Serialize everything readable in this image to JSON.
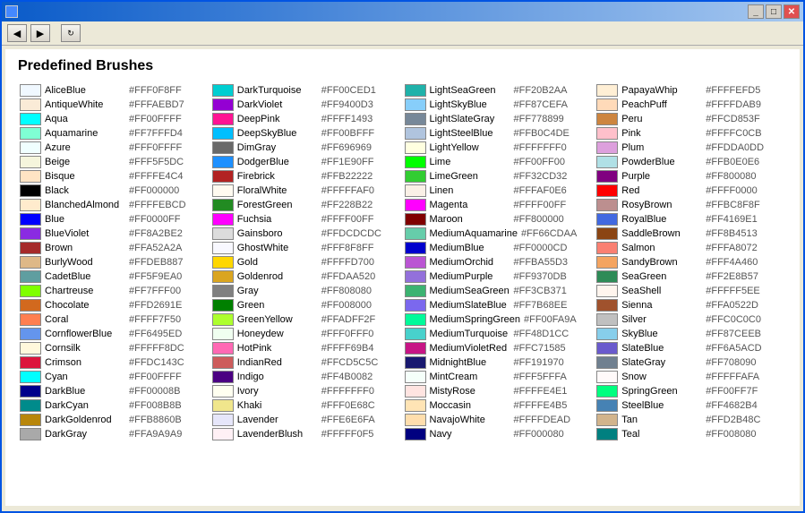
{
  "window": {
    "title": "Predefined Brushes",
    "titlebar_title": ""
  },
  "page": {
    "heading": "Predefined Brushes"
  },
  "colors": [
    {
      "name": "AliceBlue",
      "hex": "#FFF0F8FF",
      "color": "#F0F8FF"
    },
    {
      "name": "AntiqueWhite",
      "hex": "#FFFAEBD7",
      "color": "#FAEBD7"
    },
    {
      "name": "Aqua",
      "hex": "#FF00FFFF",
      "color": "#00FFFF"
    },
    {
      "name": "Aquamarine",
      "hex": "#FF7FFFD4",
      "color": "#7FFFD4"
    },
    {
      "name": "Azure",
      "hex": "#FFF0FFFF",
      "color": "#F0FFFF"
    },
    {
      "name": "Beige",
      "hex": "#FFF5F5DC",
      "color": "#F5F5DC"
    },
    {
      "name": "Bisque",
      "hex": "#FFFFE4C4",
      "color": "#FFE4C4"
    },
    {
      "name": "Black",
      "hex": "#FF000000",
      "color": "#000000"
    },
    {
      "name": "BlanchedAlmond",
      "hex": "#FFFFEBCD",
      "color": "#FFEBCD"
    },
    {
      "name": "Blue",
      "hex": "#FF0000FF",
      "color": "#0000FF"
    },
    {
      "name": "BlueViolet",
      "hex": "#FF8A2BE2",
      "color": "#8A2BE2"
    },
    {
      "name": "Brown",
      "hex": "#FFA52A2A",
      "color": "#A52A2A"
    },
    {
      "name": "BurlyWood",
      "hex": "#FFDEB887",
      "color": "#DEB887"
    },
    {
      "name": "CadetBlue",
      "hex": "#FF5F9EA0",
      "color": "#5F9EA0"
    },
    {
      "name": "Chartreuse",
      "hex": "#FF7FFF00",
      "color": "#7FFF00"
    },
    {
      "name": "Chocolate",
      "hex": "#FFD2691E",
      "color": "#D2691E"
    },
    {
      "name": "Coral",
      "hex": "#FFFF7F50",
      "color": "#FF7F50"
    },
    {
      "name": "CornflowerBlue",
      "hex": "#FF6495ED",
      "color": "#6495ED"
    },
    {
      "name": "Cornsilk",
      "hex": "#FFFFF8DC",
      "color": "#FFF8DC"
    },
    {
      "name": "Crimson",
      "hex": "#FFDC143C",
      "color": "#DC143C"
    },
    {
      "name": "Cyan",
      "hex": "#FF00FFFF",
      "color": "#00FFFF"
    },
    {
      "name": "DarkBlue",
      "hex": "#FF00008B",
      "color": "#00008B"
    },
    {
      "name": "DarkCyan",
      "hex": "#FF008B8B",
      "color": "#008B8B"
    },
    {
      "name": "DarkGoldenrod",
      "hex": "#FFB8860B",
      "color": "#B8860B"
    },
    {
      "name": "DarkGray",
      "hex": "#FFA9A9A9",
      "color": "#A9A9A9"
    },
    {
      "name": "DarkTurquoise",
      "hex": "#FF00CED1",
      "color": "#00CED1"
    },
    {
      "name": "DarkViolet",
      "hex": "#FF9400D3",
      "color": "#9400D3"
    },
    {
      "name": "DeepPink",
      "hex": "#FFFF1493",
      "color": "#FF1493"
    },
    {
      "name": "DeepSkyBlue",
      "hex": "#FF00BFFF",
      "color": "#00BFFF"
    },
    {
      "name": "DimGray",
      "hex": "#FF696969",
      "color": "#696969"
    },
    {
      "name": "DodgerBlue",
      "hex": "#FF1E90FF",
      "color": "#1E90FF"
    },
    {
      "name": "Firebrick",
      "hex": "#FFB22222",
      "color": "#B22222"
    },
    {
      "name": "FloralWhite",
      "hex": "#FFFFFAF0",
      "color": "#FFFAF0"
    },
    {
      "name": "ForestGreen",
      "hex": "#FF228B22",
      "color": "#228B22"
    },
    {
      "name": "Fuchsia",
      "hex": "#FFFF00FF",
      "color": "#FF00FF"
    },
    {
      "name": "Gainsboro",
      "hex": "#FFDCDCDC",
      "color": "#DCDCDC"
    },
    {
      "name": "GhostWhite",
      "hex": "#FFF8F8FF",
      "color": "#F8F8FF"
    },
    {
      "name": "Gold",
      "hex": "#FFFFD700",
      "color": "#FFD700"
    },
    {
      "name": "Goldenrod",
      "hex": "#FFDAA520",
      "color": "#DAA520"
    },
    {
      "name": "Gray",
      "hex": "#FF808080",
      "color": "#808080"
    },
    {
      "name": "Green",
      "hex": "#FF008000",
      "color": "#008000"
    },
    {
      "name": "GreenYellow",
      "hex": "#FFADFF2F",
      "color": "#ADFF2F"
    },
    {
      "name": "Honeydew",
      "hex": "#FFF0FFF0",
      "color": "#F0FFF0"
    },
    {
      "name": "HotPink",
      "hex": "#FFFF69B4",
      "color": "#FF69B4"
    },
    {
      "name": "IndianRed",
      "hex": "#FFCD5C5C",
      "color": "#CD5C5C"
    },
    {
      "name": "Indigo",
      "hex": "#FF4B0082",
      "color": "#4B0082"
    },
    {
      "name": "Ivory",
      "hex": "#FFFFFFF0",
      "color": "#FFFFF0"
    },
    {
      "name": "Khaki",
      "hex": "#FFF0E68C",
      "color": "#F0E68C"
    },
    {
      "name": "Lavender",
      "hex": "#FFE6E6FA",
      "color": "#E6E6FA"
    },
    {
      "name": "LavenderBlush",
      "hex": "#FFFFF0F5",
      "color": "#FFF0F5"
    },
    {
      "name": "LightSeaGreen",
      "hex": "#FF20B2AA",
      "color": "#20B2AA"
    },
    {
      "name": "LightSkyBlue",
      "hex": "#FF87CEFA",
      "color": "#87CEFA"
    },
    {
      "name": "LightSlateGray",
      "hex": "#FF778899",
      "color": "#778899"
    },
    {
      "name": "LightSteelBlue",
      "hex": "#FFB0C4DE",
      "color": "#B0C4DE"
    },
    {
      "name": "LightYellow",
      "hex": "#FFFFFFF0",
      "color": "#FFFFE0"
    },
    {
      "name": "Lime",
      "hex": "#FF00FF00",
      "color": "#00FF00"
    },
    {
      "name": "LimeGreen",
      "hex": "#FF32CD32",
      "color": "#32CD32"
    },
    {
      "name": "Linen",
      "hex": "#FFFAF0E6",
      "color": "#FAF0E6"
    },
    {
      "name": "Magenta",
      "hex": "#FFFF00FF",
      "color": "#FF00FF"
    },
    {
      "name": "Maroon",
      "hex": "#FF800000",
      "color": "#800000"
    },
    {
      "name": "MediumAquamarine",
      "hex": "#FF66CDAA",
      "color": "#66CDAA"
    },
    {
      "name": "MediumBlue",
      "hex": "#FF0000CD",
      "color": "#0000CD"
    },
    {
      "name": "MediumOrchid",
      "hex": "#FFBA55D3",
      "color": "#BA55D3"
    },
    {
      "name": "MediumPurple",
      "hex": "#FF9370DB",
      "color": "#9370DB"
    },
    {
      "name": "MediumSeaGreen",
      "hex": "#FF3CB371",
      "color": "#3CB371"
    },
    {
      "name": "MediumSlateBlue",
      "hex": "#FF7B68EE",
      "color": "#7B68EE"
    },
    {
      "name": "MediumSpringGreen",
      "hex": "#FF00FA9A",
      "color": "#00FA9A"
    },
    {
      "name": "MediumTurquoise",
      "hex": "#FF48D1CC",
      "color": "#48D1CC"
    },
    {
      "name": "MediumVioletRed",
      "hex": "#FFC71585",
      "color": "#C71585"
    },
    {
      "name": "MidnightBlue",
      "hex": "#FF191970",
      "color": "#191970"
    },
    {
      "name": "MintCream",
      "hex": "#FFF5FFFA",
      "color": "#F5FFFA"
    },
    {
      "name": "MistyRose",
      "hex": "#FFFFE4E1",
      "color": "#FFE4E1"
    },
    {
      "name": "Moccasin",
      "hex": "#FFFFE4B5",
      "color": "#FFE4B5"
    },
    {
      "name": "NavajoWhite",
      "hex": "#FFFFDEAD",
      "color": "#FFDEAD"
    },
    {
      "name": "Navy",
      "hex": "#FF000080",
      "color": "#000080"
    },
    {
      "name": "PapayaWhip",
      "hex": "#FFFFEFD5",
      "color": "#FFEFD5"
    },
    {
      "name": "PeachPuff",
      "hex": "#FFFFDAB9",
      "color": "#FFDAB9"
    },
    {
      "name": "Peru",
      "hex": "#FFCD853F",
      "color": "#CD853F"
    },
    {
      "name": "Pink",
      "hex": "#FFFFC0CB",
      "color": "#FFC0CB"
    },
    {
      "name": "Plum",
      "hex": "#FFDDA0DD",
      "color": "#DDA0DD"
    },
    {
      "name": "PowderBlue",
      "hex": "#FFB0E0E6",
      "color": "#B0E0E6"
    },
    {
      "name": "Purple",
      "hex": "#FF800080",
      "color": "#800080"
    },
    {
      "name": "Red",
      "hex": "#FFFF0000",
      "color": "#FF0000"
    },
    {
      "name": "RosyBrown",
      "hex": "#FFBC8F8F",
      "color": "#BC8F8F"
    },
    {
      "name": "RoyalBlue",
      "hex": "#FF4169E1",
      "color": "#4169E1"
    },
    {
      "name": "SaddleBrown",
      "hex": "#FF8B4513",
      "color": "#8B4513"
    },
    {
      "name": "Salmon",
      "hex": "#FFFA8072",
      "color": "#FA8072"
    },
    {
      "name": "SandyBrown",
      "hex": "#FFF4A460",
      "color": "#F4A460"
    },
    {
      "name": "SeaGreen",
      "hex": "#FF2E8B57",
      "color": "#2E8B57"
    },
    {
      "name": "SeaShell",
      "hex": "#FFFFF5EE",
      "color": "#FFF5EE"
    },
    {
      "name": "Sienna",
      "hex": "#FFA0522D",
      "color": "#A0522D"
    },
    {
      "name": "Silver",
      "hex": "#FFC0C0C0",
      "color": "#C0C0C0"
    },
    {
      "name": "SkyBlue",
      "hex": "#FF87CEEB",
      "color": "#87CEEB"
    },
    {
      "name": "SlateBlue",
      "hex": "#FF6A5ACD",
      "color": "#6A5ACD"
    },
    {
      "name": "SlateGray",
      "hex": "#FF708090",
      "color": "#708090"
    },
    {
      "name": "Snow",
      "hex": "#FFFFFAFA",
      "color": "#FFFAFA"
    },
    {
      "name": "SpringGreen",
      "hex": "#FF00FF7F",
      "color": "#00FF7F"
    },
    {
      "name": "SteelBlue",
      "hex": "#FF4682B4",
      "color": "#4682B4"
    },
    {
      "name": "Tan",
      "hex": "#FFD2B48C",
      "color": "#D2B48C"
    },
    {
      "name": "Teal",
      "hex": "#FF008080",
      "color": "#008080"
    }
  ]
}
